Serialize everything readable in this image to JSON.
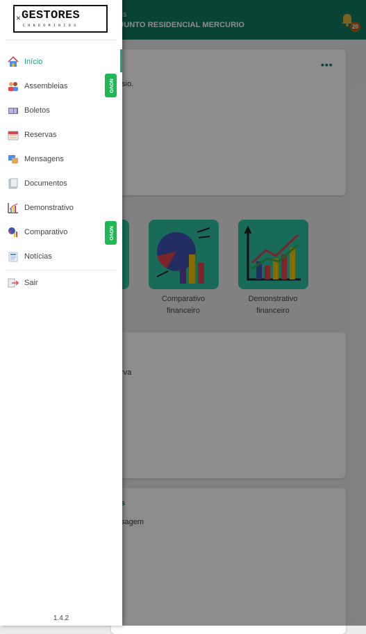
{
  "header": {
    "subtitle": "lis",
    "condo_name": "JUNTO RESIDENCIAL MERCURIO",
    "notification_count": "20"
  },
  "main": {
    "welcome_card_text": "sio.",
    "tiles": [
      {
        "label_line1": "Comparativo",
        "label_line2": "financeiro"
      },
      {
        "label_line1": "Demonstrativo",
        "label_line2": "financeiro"
      }
    ],
    "reserva_card_text": "rva",
    "mensagem_card_title": "s",
    "mensagem_card_text": "sagem"
  },
  "drawer": {
    "logo_main": "GESTORES",
    "logo_sub": "CONDOMINIOS",
    "logo_close": "×",
    "items": [
      {
        "label": "Início",
        "icon": "home-icon",
        "active": true
      },
      {
        "label": "Assembleias",
        "icon": "people-icon",
        "badge": "NOVO"
      },
      {
        "label": "Boletos",
        "icon": "barcode-icon"
      },
      {
        "label": "Reservas",
        "icon": "calendar-icon"
      },
      {
        "label": "Mensagens",
        "icon": "chat-icon"
      },
      {
        "label": "Documentos",
        "icon": "document-icon"
      },
      {
        "label": "Demonstrativo",
        "icon": "chart-icon"
      },
      {
        "label": "Comparativo",
        "icon": "comparison-icon",
        "badge": "NOVO"
      },
      {
        "label": "Notícias",
        "icon": "news-icon"
      }
    ],
    "logout_label": "Sair",
    "version": "1.4.2"
  },
  "colors": {
    "primary": "#127a62",
    "accent": "#1a9f80",
    "badge": "#1db954",
    "tile": "#2ec4a3"
  }
}
